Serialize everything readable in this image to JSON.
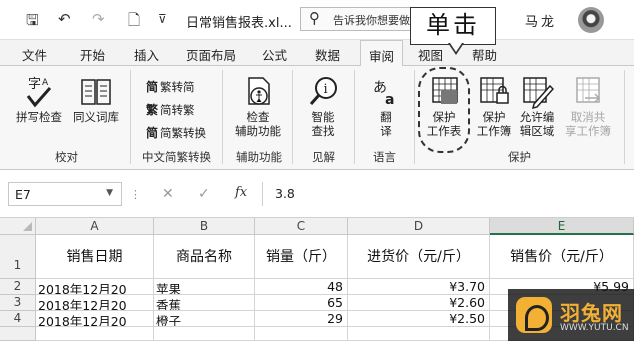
{
  "titlebar": {
    "save_glyph": "🖫",
    "undo_glyph": "↶",
    "redo_glyph": "↷",
    "new_glyph": "🗋",
    "qat_glyph": "⊽",
    "title": "日常销售报表.xl...",
    "tellme_placeholder": "告诉我你想要做什么",
    "user": "马龙"
  },
  "tabs": [
    "文件",
    "开始",
    "插入",
    "页面布局",
    "公式",
    "数据",
    "审阅",
    "视图",
    "帮助"
  ],
  "active_tab": "审阅",
  "ribbon": {
    "proofing": {
      "spell": "拼写检查",
      "thesaurus": "同义词库",
      "label": "校对"
    },
    "chinese": {
      "to_simplified": "繁转简",
      "to_traditional": "简转繁",
      "convert": "简繁转换",
      "label": "中文简繁转换",
      "trad_glyph": "繁",
      "simp_glyph": "简"
    },
    "accessibility": {
      "check_line1": "检查",
      "check_line2": "辅助功能",
      "label": "辅助功能"
    },
    "insights": {
      "smart_line1": "智能",
      "smart_line2": "查找",
      "label": "见解"
    },
    "language": {
      "translate_line1": "翻",
      "translate_line2": "译",
      "label": "语言"
    },
    "protect": {
      "protect_sheet_line1": "保护",
      "protect_sheet_line2": "工作表",
      "protect_workbook_line1": "保护",
      "protect_workbook_line2": "工作簿",
      "allow_edit_line1": "允许编",
      "allow_edit_line2": "辑区域",
      "unshare_line1": "取消共",
      "unshare_line2": "享工作簿",
      "label": "保护"
    }
  },
  "callout": {
    "text": "单击"
  },
  "formula_bar": {
    "name_box": "E7",
    "cancel": "✕",
    "enter": "✓",
    "fx": "fx",
    "value": "3.8"
  },
  "sheet": {
    "columns": [
      "A",
      "B",
      "C",
      "D",
      "E"
    ],
    "selected_column": "E",
    "rows": [
      "1",
      "2",
      "3",
      "4"
    ],
    "header": [
      "销售日期",
      "商品名称",
      "销量（斤）",
      "进货价（元/斤）",
      "销售价（元/斤）"
    ],
    "data": [
      [
        "2018年12月20",
        "苹果",
        "48",
        "¥3.70",
        "¥5.99"
      ],
      [
        "2018年12月20",
        "香蕉",
        "65",
        "¥2.60",
        ""
      ],
      [
        "2018年12月20",
        "橙子",
        "29",
        "¥2.50",
        ""
      ]
    ]
  },
  "watermark": {
    "name": "羽兔网",
    "url": "WWW.YUTU.CN"
  },
  "colors": {
    "excel_green": "#217346",
    "ribbon_bg": "#f7f7f7",
    "watermark_gold": "#f2b134"
  }
}
